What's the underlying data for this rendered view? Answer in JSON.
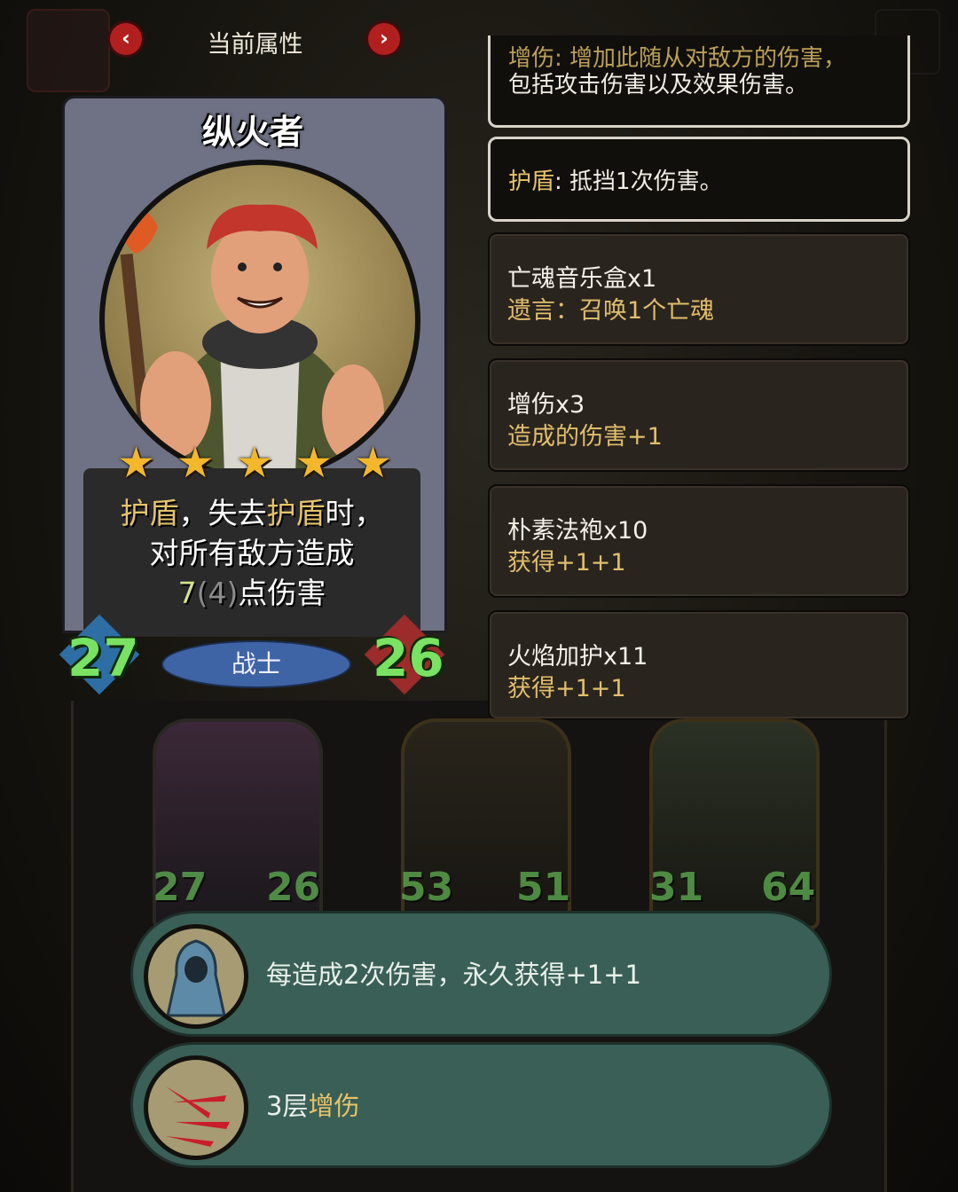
{
  "header": {
    "title": "当前属性",
    "prev_icon": "chevron-left-icon",
    "next_icon": "chevron-right-icon"
  },
  "hero": {
    "name": "纵火者",
    "stars": 5,
    "ability": {
      "kw1": "护盾",
      "t1": "，失去",
      "kw2": "护盾",
      "t2": "时，",
      "line2": "对所有敌方造成",
      "dmg": "7",
      "base": "(4)",
      "t3": "点伤害"
    },
    "attack": "27",
    "health": "26",
    "class": "战士"
  },
  "keywords": [
    {
      "line1_partial": "增伤: 增加此随从对敌方的伤害，",
      "line2": "包括攻击伤害以及效果伤害。"
    },
    {
      "name": "护盾",
      "sep": ": ",
      "desc": "抵挡1次伤害。"
    }
  ],
  "items": [
    {
      "name": "亡魂音乐盒x1",
      "desc": "遗言：召唤1个亡魂"
    },
    {
      "name": "增伤x3",
      "desc": "造成的伤害+1"
    },
    {
      "name": "朴素法袍x10",
      "desc": "获得+1+1"
    },
    {
      "name": "火焰加护x11",
      "desc": "获得+1+1"
    }
  ],
  "team": [
    {
      "attack": "27",
      "health": "26"
    },
    {
      "attack": "53",
      "health": "51"
    },
    {
      "attack": "31",
      "health": "64"
    }
  ],
  "buffs": [
    {
      "icon": "hooded-robe-icon",
      "text": "每造成2次伤害，永久获得+1+1"
    },
    {
      "icon": "claw-scratch-icon",
      "prefix": "3层",
      "keyword": "增伤"
    }
  ],
  "colors": {
    "keyword_gold": "#e6c36a",
    "stat_green": "#79e263",
    "buff_bg": "#3a5f56",
    "nav_red": "#b21f1f"
  }
}
